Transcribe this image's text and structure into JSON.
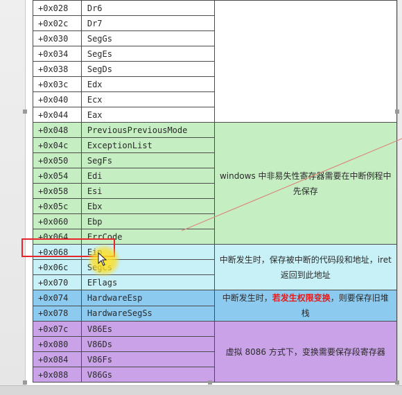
{
  "rows": [
    {
      "offset": "+0x028",
      "field": "Dr6",
      "group": "white"
    },
    {
      "offset": "+0x02c",
      "field": "Dr7",
      "group": "white"
    },
    {
      "offset": "+0x030",
      "field": "SegGs",
      "group": "white"
    },
    {
      "offset": "+0x034",
      "field": "SegEs",
      "group": "white"
    },
    {
      "offset": "+0x038",
      "field": "SegDs",
      "group": "white"
    },
    {
      "offset": "+0x03c",
      "field": "Edx",
      "group": "white"
    },
    {
      "offset": "+0x040",
      "field": "Ecx",
      "group": "white"
    },
    {
      "offset": "+0x044",
      "field": "Eax",
      "group": "white"
    },
    {
      "offset": "+0x048",
      "field": "PreviousPreviousMode",
      "group": "green"
    },
    {
      "offset": "+0x04c",
      "field": "ExceptionList",
      "group": "green"
    },
    {
      "offset": "+0x050",
      "field": "SegFs",
      "group": "green"
    },
    {
      "offset": "+0x054",
      "field": "Edi",
      "group": "green"
    },
    {
      "offset": "+0x058",
      "field": "Esi",
      "group": "green"
    },
    {
      "offset": "+0x05c",
      "field": "Ebx",
      "group": "green"
    },
    {
      "offset": "+0x060",
      "field": "Ebp",
      "group": "green"
    },
    {
      "offset": "+0x064",
      "field": "ErrCode",
      "group": "green"
    },
    {
      "offset": "+0x068",
      "field": "Eip",
      "group": "cyan"
    },
    {
      "offset": "+0x06c",
      "field": "SegCs",
      "group": "cyan"
    },
    {
      "offset": "+0x070",
      "field": "EFlags",
      "group": "cyan"
    },
    {
      "offset": "+0x074",
      "field": "HardwareEsp",
      "group": "blue"
    },
    {
      "offset": "+0x078",
      "field": "HardwareSegSs",
      "group": "blue"
    },
    {
      "offset": "+0x07c",
      "field": "V86Es",
      "group": "purple"
    },
    {
      "offset": "+0x080",
      "field": "V86Ds",
      "group": "purple"
    },
    {
      "offset": "+0x084",
      "field": "V86Fs",
      "group": "purple"
    },
    {
      "offset": "+0x088",
      "field": "V86Gs",
      "group": "purple"
    }
  ],
  "descriptions": {
    "white": "",
    "green": "windows 中非易失性寄存器需要在中断例程中先保存",
    "cyan": "中断发生时，保存被中断的代码段和地址，iret 返回到此地址",
    "blue_before": "中断发生时，",
    "blue_warning": "若发生权限变换",
    "blue_after": "，则要保存旧堆栈",
    "purple": "虚拟 8086 方式下，变换需要保存段寄存器"
  },
  "colors": {
    "white": "#ffffff",
    "green": "#c6eec3",
    "cyan": "#c7f1f6",
    "blue": "#8ccaf0",
    "purple": "#c9a2e8",
    "highlight": "#e8232a",
    "warning_text": "#e31b1b"
  },
  "highlighted_row": "+0x068",
  "cursor": "arrow-cursor"
}
